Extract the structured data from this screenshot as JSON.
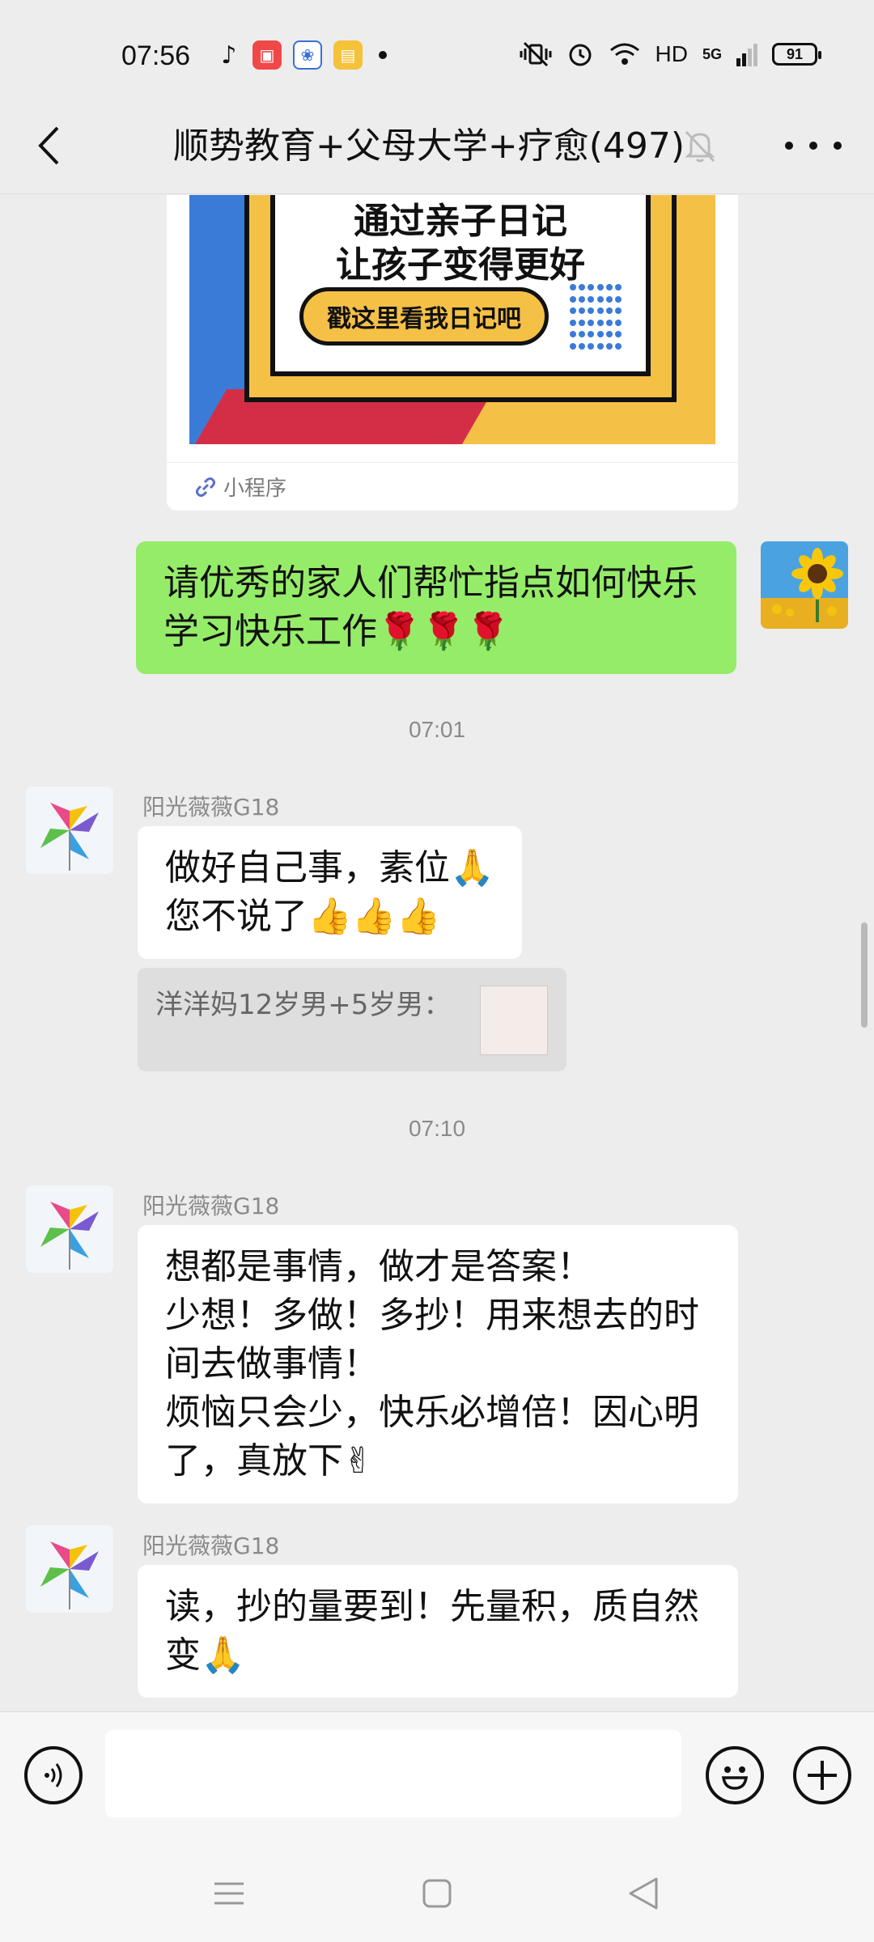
{
  "status_bar": {
    "time": "07:56",
    "network": "HD",
    "signal": "5G",
    "battery": "91"
  },
  "header": {
    "title": "顺势教育+父母大学+疗愈(497)"
  },
  "mini_program": {
    "line1": "通过亲子日记",
    "line2": "让孩子变得更好",
    "button": "戳这里看我日记吧",
    "footer_label": "小程序"
  },
  "messages": [
    {
      "text": "请优秀的家人们帮忙指点如何快乐学习快乐工作🌹🌹🌹"
    },
    {
      "sender": "阳光薇薇G18",
      "text": "做好自己事，素位🙏\n您不说了👍👍👍"
    },
    {
      "sender": "阳光薇薇G18",
      "text": "想都是事情，做才是答案！\n少想！多做！多抄！用来想去的时间去做事情！\n烦恼只会少，快乐必增倍！因心明了，真放下✌"
    },
    {
      "sender": "阳光薇薇G18",
      "text": "读，抄的量要到！先量积，质自然变🙏"
    }
  ],
  "timestamps": [
    "07:01",
    "07:10"
  ],
  "quote": {
    "text": "洋洋妈12岁男+5岁男："
  },
  "colors": {
    "background": "#ededed",
    "bubble_self": "#95ec69",
    "bubble_other": "#ffffff"
  }
}
